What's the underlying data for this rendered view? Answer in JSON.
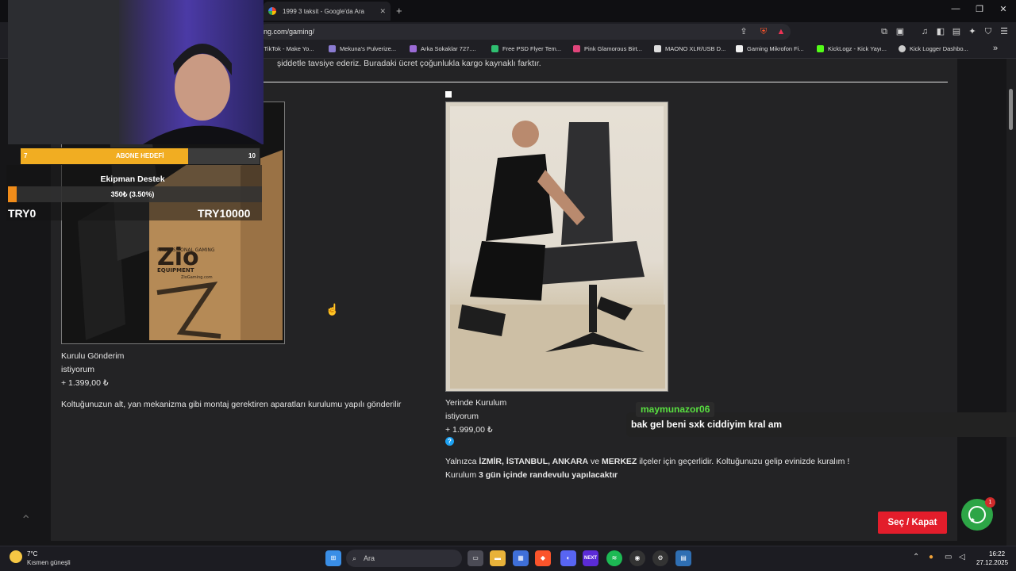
{
  "browser": {
    "tab_title": "1999 3 taksit - Google'da Ara",
    "new_tab_glyph": "+",
    "url": "ing.com/gaming/",
    "window_controls": [
      "—",
      "❐",
      "✕"
    ],
    "bookmarks": [
      {
        "label": ")TikTok - Make Yo...",
        "color": "#111111"
      },
      {
        "label": "Mekuna's Pulverize...",
        "color": "#8a7bd1"
      },
      {
        "label": "Arka Sokaklar 727....",
        "color": "#9b6bd6"
      },
      {
        "label": "Free PSD Flyer Tem...",
        "color": "#2fbf71"
      },
      {
        "label": "Pink Glamorous Birt...",
        "color": "#e0457b"
      },
      {
        "label": "MAONO XLR/USB D...",
        "color": "#dddddd"
      },
      {
        "label": "Gaming Mikrofon Fi...",
        "color": "#f0f0f0"
      },
      {
        "label": "KickLogz - Kick Yayı...",
        "color": "#53fc18"
      },
      {
        "label": "Kick Logger Dashbo...",
        "color": "#cccccc"
      }
    ],
    "more_bookmarks_glyph": "»"
  },
  "page": {
    "intro": "şiddetle tavsiye ederiz. Buradaki ücret çoğunlukla kargo kaynaklı farktır.",
    "left_option": {
      "title": "Kurulu Gönderim",
      "want": "istiyorum",
      "price": "+ 1.399,00 ₺",
      "description": "Koltuğunuzun alt, yan mekanizma gibi montaj gerektiren aparatları kurulumu yapılı gönderilir",
      "box_brand": "Zio",
      "box_line1": "PROFESSIONAL GAMING",
      "box_line2": "EQUIPMENT",
      "box_site": "ZioGaming.com"
    },
    "right_option": {
      "title": "Yerinde Kurulum",
      "want": "istiyorum",
      "price": "+ 1.999,00 ₺",
      "info_glyph": "?",
      "note_prefix": "Yalnızca ",
      "note_cities": "İZMİR, İSTANBUL, ANKARA",
      "note_ve": " ve ",
      "note_merkez": "MERKEZ",
      "note_suffix": " ilçeler için geçerlidir. Koltuğunuzu gelip evinizde kuralım !",
      "schedule_prefix": "Kurulum ",
      "schedule_bold": "3 gün içinde randevulu yapılacaktır"
    },
    "select_button": "Seç / Kapat",
    "whatsapp_badge": "1",
    "up_arrow": "⌃"
  },
  "stream_overlay": {
    "goal_current": "7",
    "goal_label": "ABONE HEDEFİ",
    "goal_target": "10",
    "goal_progress": 0.7,
    "donation_title": "Ekipman Destek",
    "donation_value": "350₺ (3.50%)",
    "donation_progress": 0.035,
    "donation_min": "TRY0",
    "donation_max": "TRY10000",
    "chat_user": "maymunazor06",
    "chat_message": "bak gel beni sxk ciddiyim kral am"
  },
  "taskbar": {
    "weather_temp": "7°C",
    "weather_desc": "Kısmen güneşli",
    "search_placeholder": "Ara",
    "time": "16:22",
    "date": "27.12.2025",
    "next_label": "NEXT"
  }
}
